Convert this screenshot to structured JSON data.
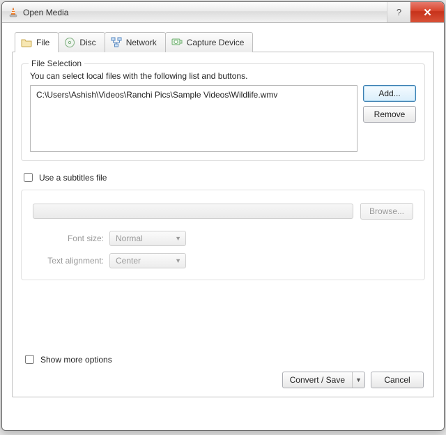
{
  "window": {
    "title": "Open Media"
  },
  "tabs": {
    "file": {
      "label": "File"
    },
    "disc": {
      "label": "Disc"
    },
    "network": {
      "label": "Network"
    },
    "capture": {
      "label": "Capture Device"
    }
  },
  "fileSelection": {
    "legend": "File Selection",
    "hint": "You can select local files with the following list and buttons.",
    "files": [
      "C:\\Users\\Ashish\\Videos\\Ranchi Pics\\Sample Videos\\Wildlife.wmv"
    ],
    "addLabel": "Add...",
    "removeLabel": "Remove"
  },
  "subtitles": {
    "useLabel": "Use a subtitles file",
    "browseLabel": "Browse...",
    "fontSizeLabel": "Font size:",
    "fontSizeValue": "Normal",
    "alignLabel": "Text alignment:",
    "alignValue": "Center"
  },
  "footer": {
    "showMoreLabel": "Show more options",
    "convertLabel": "Convert / Save",
    "cancelLabel": "Cancel"
  }
}
